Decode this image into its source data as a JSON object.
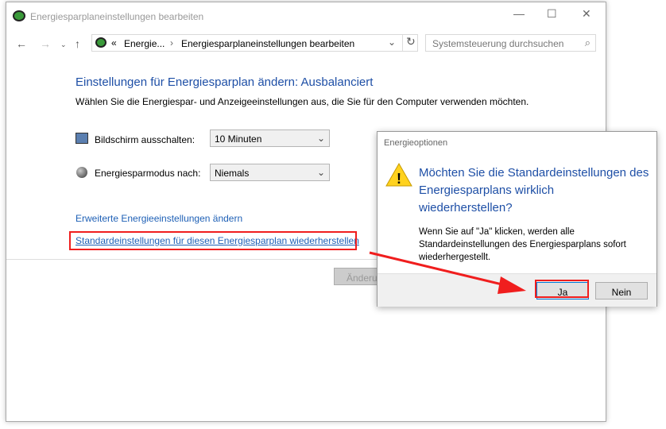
{
  "window": {
    "title": "Energiesparplaneinstellungen bearbeiten"
  },
  "address": {
    "crumb1": "Energie...",
    "crumb2": "Energiesparplaneinstellungen bearbeiten"
  },
  "search": {
    "placeholder": "Systemsteuerung durchsuchen"
  },
  "main": {
    "heading": "Einstellungen für Energiesparplan ändern: Ausbalanciert",
    "subtitle": "Wählen Sie die Energiespar- und Anzeigeeinstellungen aus, die Sie für den Computer verwenden möchten.",
    "display_label": "Bildschirm ausschalten:",
    "display_value": "10 Minuten",
    "sleep_label": "Energiesparmodus nach:",
    "sleep_value": "Niemals",
    "advanced_link": "Erweiterte Energieeinstellungen ändern",
    "restore_link": "Standardeinstellungen für diesen Energiesparplan wiederherstellen",
    "save_button": "Änderu"
  },
  "dialog": {
    "title": "Energieoptionen",
    "question": "Möchten Sie die Standardeinstellungen des Energiesparplans wirklich wiederherstellen?",
    "body": "Wenn Sie auf \"Ja\" klicken, werden alle Standardeinstellungen des Energiesparplans sofort wiederhergestellt.",
    "yes": "Ja",
    "no": "Nein"
  }
}
